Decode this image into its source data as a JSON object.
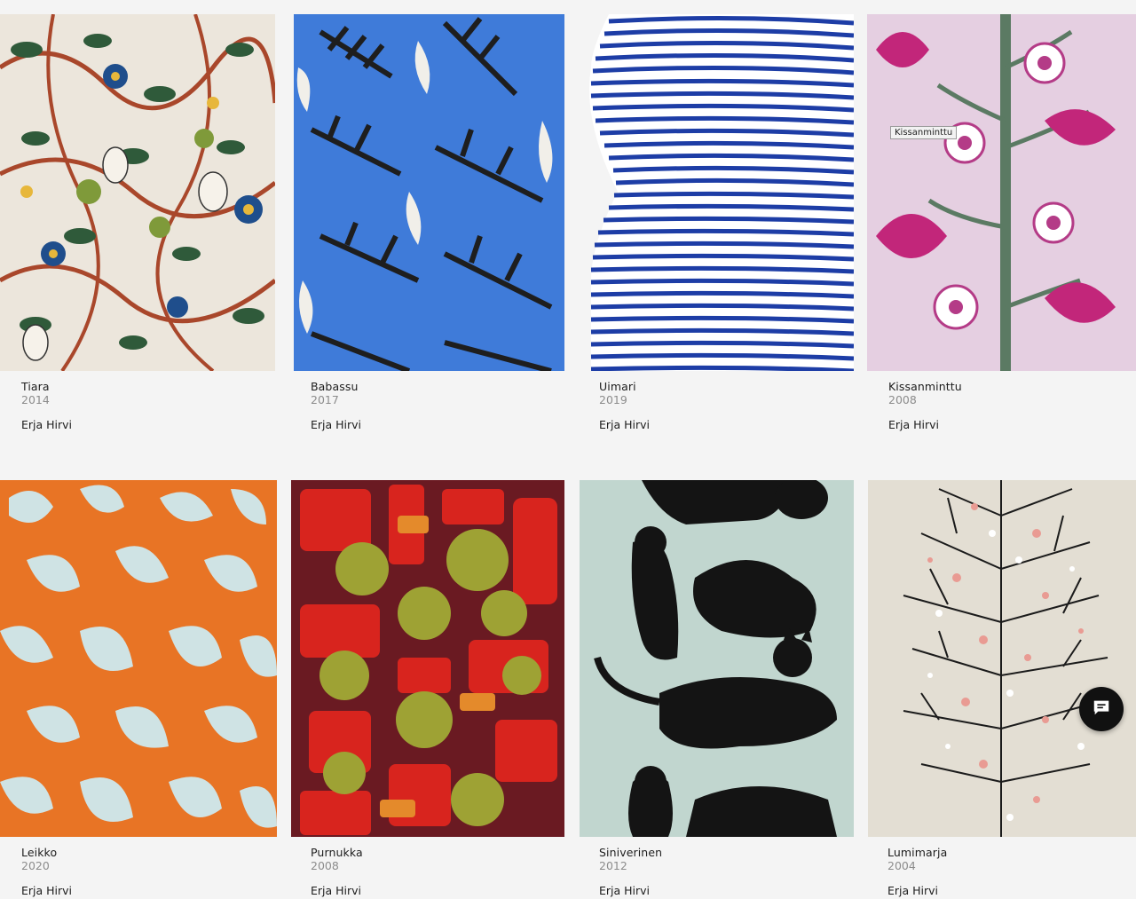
{
  "products": [
    {
      "name": "Tiara",
      "year": "2014",
      "designer": "Erja Hirvi"
    },
    {
      "name": "Babassu",
      "year": "2017",
      "designer": "Erja Hirvi"
    },
    {
      "name": "Uimari",
      "year": "2019",
      "designer": "Erja Hirvi"
    },
    {
      "name": "Kissanminttu",
      "year": "2008",
      "designer": "Erja Hirvi"
    },
    {
      "name": "Leikko",
      "year": "2020",
      "designer": "Erja Hirvi"
    },
    {
      "name": "Purnukka",
      "year": "2008",
      "designer": "Erja Hirvi"
    },
    {
      "name": "Siniverinen",
      "year": "2012",
      "designer": "Erja Hirvi"
    },
    {
      "name": "Lumimarja",
      "year": "2004",
      "designer": "Erja Hirvi"
    }
  ],
  "tooltip": "Kissanminttu",
  "chat": {
    "icon": "chat-bubble-icon"
  },
  "colors": {
    "background": "#f4f4f4",
    "chat_button": "#111111"
  }
}
